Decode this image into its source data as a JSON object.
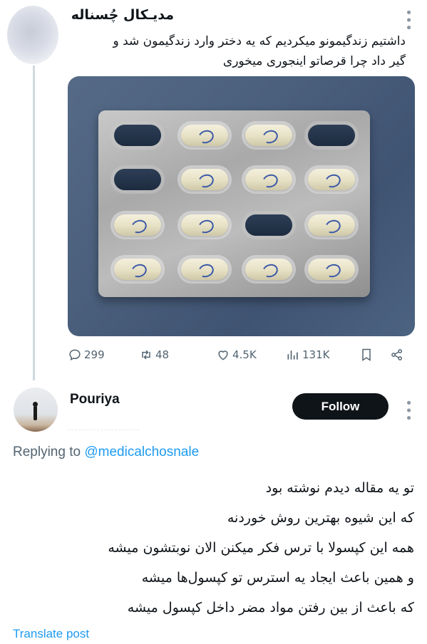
{
  "tweet": {
    "author_name": "مدیـکال چُسناله",
    "text_lines": [
      "داشتیم زندگیمونو میکردیم که یه دختر وارد زندگیمون شد و",
      "گیر داد چرا قرصاتو اینجوری میخوری"
    ],
    "stats": {
      "replies": "299",
      "retweets": "48",
      "likes": "4.5K",
      "views": "131K"
    },
    "icons": {
      "reply": "reply-icon",
      "retweet": "retweet-icon",
      "like": "heart-icon",
      "views": "views-icon",
      "bookmark": "bookmark-icon",
      "share": "share-icon",
      "more": "more-icon"
    }
  },
  "reply": {
    "author_name": "Pouriya",
    "follow_label": "Follow",
    "replying_prefix": "Replying to",
    "replying_handle": "@medicalchosnale",
    "text_lines": [
      "تو یه مقاله دیدم نوشته بود",
      "که این شیوه بهترین روش خوردنه",
      "همه این کپسولا با ترس فکر میکنن الان نوبتشون میشه",
      "و همین باعث ایجاد یه استرس تو کپسول‌ها میشه",
      "که باعث از بین رفتن مواد مضر داخل کپسول میشه"
    ],
    "translate_label": "Translate post"
  },
  "colors": {
    "accent": "#1d9bf0",
    "text": "#0f1419",
    "muted": "#536471",
    "follow_bg": "#0f1419"
  }
}
